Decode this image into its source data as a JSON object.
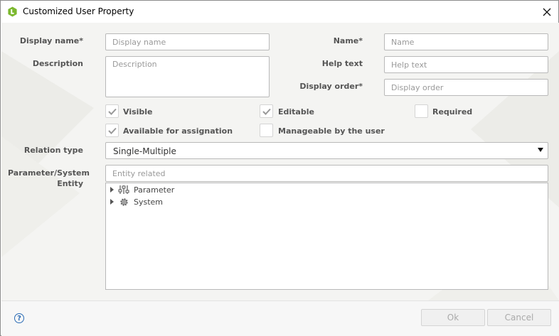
{
  "window": {
    "title": "Customized User Property"
  },
  "form": {
    "display_name": {
      "label": "Display name*",
      "placeholder": "Display name",
      "value": ""
    },
    "name": {
      "label": "Name*",
      "placeholder": "Name",
      "value": ""
    },
    "description": {
      "label": "Description",
      "placeholder": "Description",
      "value": ""
    },
    "help_text": {
      "label": "Help text",
      "placeholder": "Help text",
      "value": ""
    },
    "display_order": {
      "label": "Display order*",
      "placeholder": "Display order",
      "value": ""
    },
    "checkboxes": {
      "visible": {
        "label": "Visible",
        "checked": true
      },
      "editable": {
        "label": "Editable",
        "checked": true
      },
      "required": {
        "label": "Required",
        "checked": false
      },
      "available": {
        "label": "Available for assignation",
        "checked": true
      },
      "manageable": {
        "label": "Manageable by the user",
        "checked": false
      }
    },
    "relation_type": {
      "label": "Relation type",
      "value": "Single-Multiple"
    },
    "entity": {
      "label_line1": "Parameter/System",
      "label_line2": "Entity",
      "placeholder": "Entity related",
      "tree": [
        {
          "label": "Parameter",
          "icon": "sliders-icon"
        },
        {
          "label": "System",
          "icon": "gear-icon"
        }
      ]
    }
  },
  "footer": {
    "help_glyph": "?",
    "ok_label": "Ok",
    "cancel_label": "Cancel"
  },
  "colors": {
    "accent": "#7cb82f",
    "help_blue": "#2a6bb5",
    "panel_bg": "#f4f4f2"
  }
}
